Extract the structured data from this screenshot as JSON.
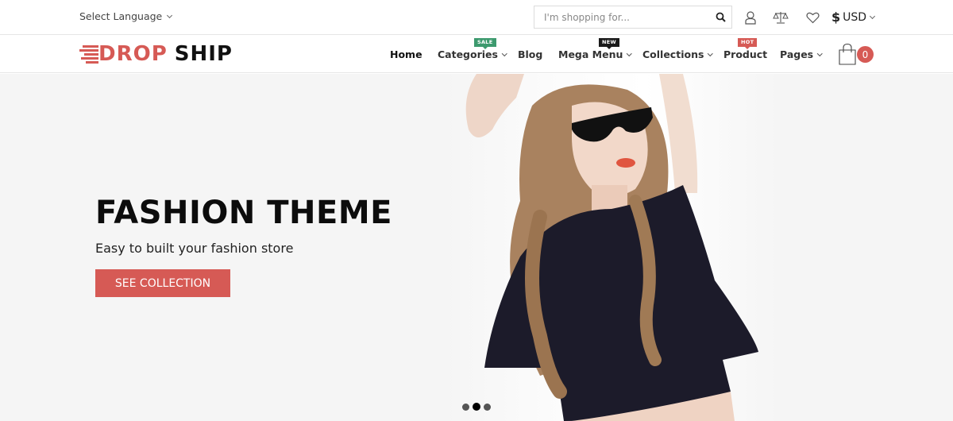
{
  "topbar": {
    "language_label": "Select Language",
    "search_placeholder": "I'm shopping for...",
    "icons": [
      "search-icon",
      "user-icon",
      "compare-scale-icon",
      "heart-icon"
    ],
    "currency_symbol": "$",
    "currency_code": "USD"
  },
  "navbar": {
    "logo_part1": "DROP",
    "logo_part2": "SHIP",
    "items": [
      {
        "label": "Home",
        "has_dropdown": false,
        "badge": null
      },
      {
        "label": "Categories",
        "has_dropdown": true,
        "badge": "SALE"
      },
      {
        "label": "Blog",
        "has_dropdown": false,
        "badge": null
      },
      {
        "label": "Mega Menu",
        "has_dropdown": true,
        "badge": "NEW"
      },
      {
        "label": "Collections",
        "has_dropdown": true,
        "badge": null
      },
      {
        "label": "Product",
        "has_dropdown": false,
        "badge": "HOT"
      },
      {
        "label": "Pages",
        "has_dropdown": true,
        "badge": null
      }
    ],
    "badge_colors": {
      "SALE": "#3d9a6e",
      "NEW": "#1a1a1a",
      "HOT": "#d65a55"
    },
    "cart_count": "0"
  },
  "hero": {
    "title": "FASHION THEME",
    "subtitle": "Easy to built your fashion store",
    "button_label": "SEE COLLECTION",
    "image_alt": "Woman in sunglasses and black crop t-shirt",
    "slides": 3,
    "active_slide": 2
  },
  "colors": {
    "accent": "#d65a55",
    "hero_bg": "#f5f5f5"
  }
}
